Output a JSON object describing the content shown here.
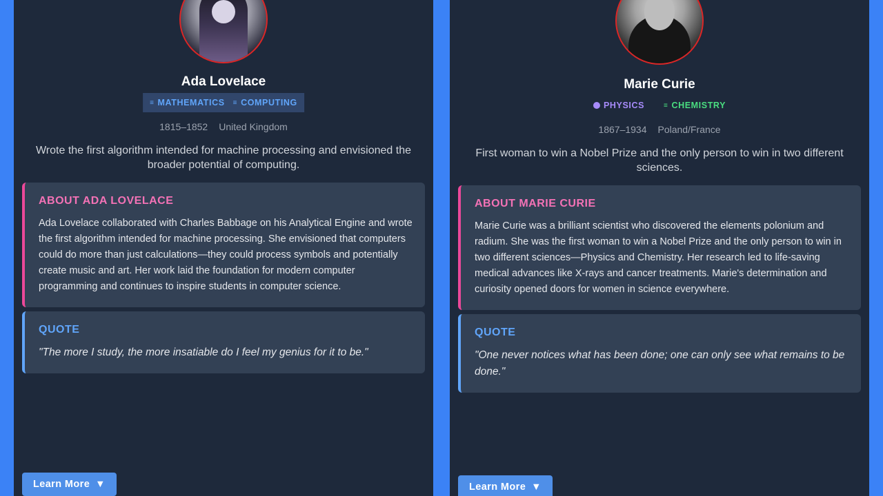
{
  "cards": [
    {
      "name": "Ada Lovelace",
      "tags": [
        {
          "label": "MATHEMATICS",
          "icon": "layers-icon"
        },
        {
          "label": "COMPUTING",
          "icon": "layers-icon"
        }
      ],
      "years": "1815–1852",
      "country": "United Kingdom",
      "summary": "Wrote the first algorithm intended for machine processing and envisioned the broader potential of computing.",
      "about_title": "ABOUT ADA LOVELACE",
      "about_text": "Ada Lovelace collaborated with Charles Babbage on his Analytical Engine and wrote the first algorithm intended for machine processing. She envisioned that computers could do more than just calculations—they could process symbols and potentially create music and art. Her work laid the foundation for modern computer programming and continues to inspire students in computer science.",
      "quote_title": "QUOTE",
      "quote_text": "\"The more I study, the more insatiable do I feel my genius for it to be.\"",
      "button_label": "Learn More",
      "button_icon": "▼"
    },
    {
      "name": "Marie Curie",
      "tags": [
        {
          "label": "PHYSICS",
          "icon": "circle-icon"
        },
        {
          "label": "CHEMISTRY",
          "icon": "layers-icon"
        }
      ],
      "years": "1867–1934",
      "country": "Poland/France",
      "summary": "First woman to win a Nobel Prize and the only person to win in two different sciences.",
      "about_title": "ABOUT MARIE CURIE",
      "about_text": "Marie Curie was a brilliant scientist who discovered the elements polonium and radium. She was the first woman to win a Nobel Prize and the only person to win in two different sciences—Physics and Chemistry. Her research led to life-saving medical advances like X-rays and cancer treatments. Marie's determination and curiosity opened doors for women in science everywhere.",
      "quote_title": "QUOTE",
      "quote_text": "\"One never notices what has been done; one can only see what remains to be done.\"",
      "button_label": "Learn More",
      "button_icon": "▼"
    }
  ],
  "colors": {
    "page_bg": "#3b82f6",
    "card_bg": "#1e293b",
    "panel_bg": "#334155",
    "about_accent": "#ec4899",
    "quote_accent": "#60a5fa",
    "avatar_border": "#dc2626"
  }
}
